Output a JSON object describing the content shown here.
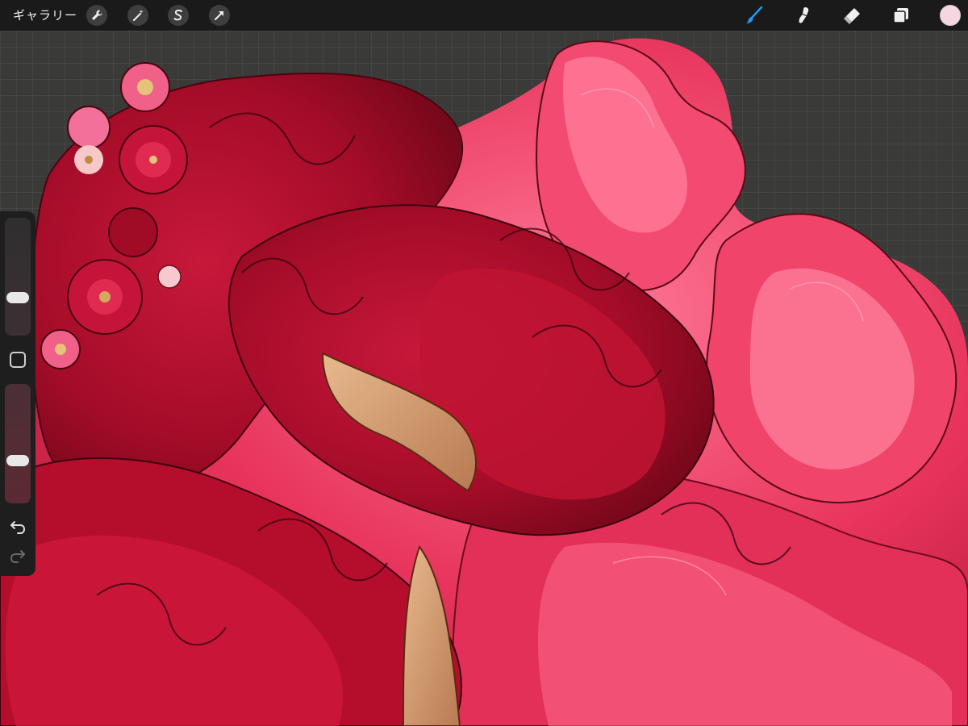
{
  "topbar": {
    "gallery_label": "ギャラリー",
    "left_tools": [
      {
        "name": "actions",
        "icon": "wrench-icon"
      },
      {
        "name": "adjustments",
        "icon": "magic-wand-icon"
      },
      {
        "name": "selection",
        "icon": "selection-s-icon"
      },
      {
        "name": "transform",
        "icon": "arrow-cursor-icon"
      }
    ],
    "right_tools": [
      {
        "name": "brush",
        "icon": "brush-icon",
        "active": true
      },
      {
        "name": "smudge",
        "icon": "smudge-finger-icon"
      },
      {
        "name": "eraser",
        "icon": "eraser-icon"
      },
      {
        "name": "layers",
        "icon": "layers-icon"
      }
    ],
    "current_color": "#f6d6e0",
    "accent_color": "#1e9cf0"
  },
  "sidebar": {
    "brush_size_level": 0.3,
    "opacity_level": 0.34,
    "modify_icon": "square-modify-icon",
    "undo_icon": "undo-arrow-icon",
    "redo_icon": "redo-arrow-icon"
  },
  "canvas": {
    "background": "#3a3a38",
    "dominant_colors": [
      "#b0102a",
      "#e8325a",
      "#ff6a8a",
      "#7a0a1e",
      "#d9a07a"
    ]
  }
}
